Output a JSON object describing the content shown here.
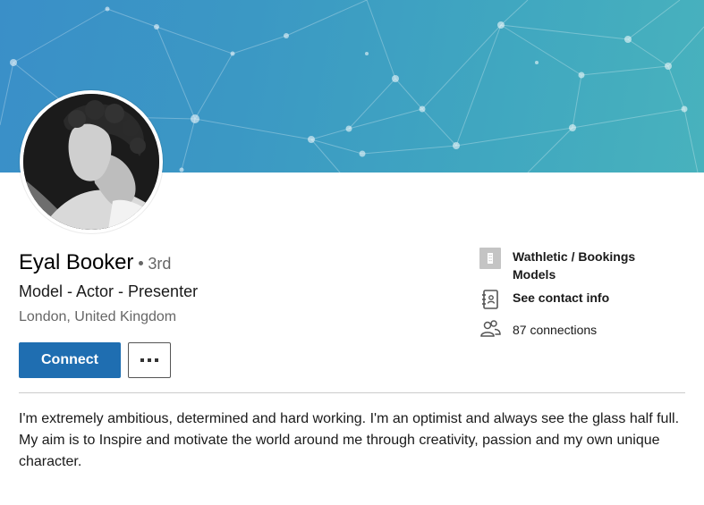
{
  "profile": {
    "name": "Eyal Booker",
    "degree": "3rd",
    "headline": "Model - Actor - Presenter",
    "location": "London, United Kingdom",
    "summary": "I'm extremely ambitious, determined and hard working. I'm an optimist and always see the glass half full. My aim is to Inspire and motivate the world around me through creativity, passion and my own unique character."
  },
  "actions": {
    "connect_label": "Connect",
    "more_icon": "ellipsis-icon"
  },
  "sidebar": {
    "company": {
      "label": "Wathletic / Bookings Models",
      "icon": "building-icon"
    },
    "contact": {
      "label": "See contact info",
      "icon": "contact-card-icon"
    },
    "connections": {
      "label": "87 connections",
      "icon": "people-icon"
    }
  },
  "colors": {
    "accent": "#1f6eb1",
    "banner_start": "#3a8fc8",
    "banner_end": "#48b2bd",
    "secondary_text": "#666666",
    "divider": "#cccccc"
  }
}
